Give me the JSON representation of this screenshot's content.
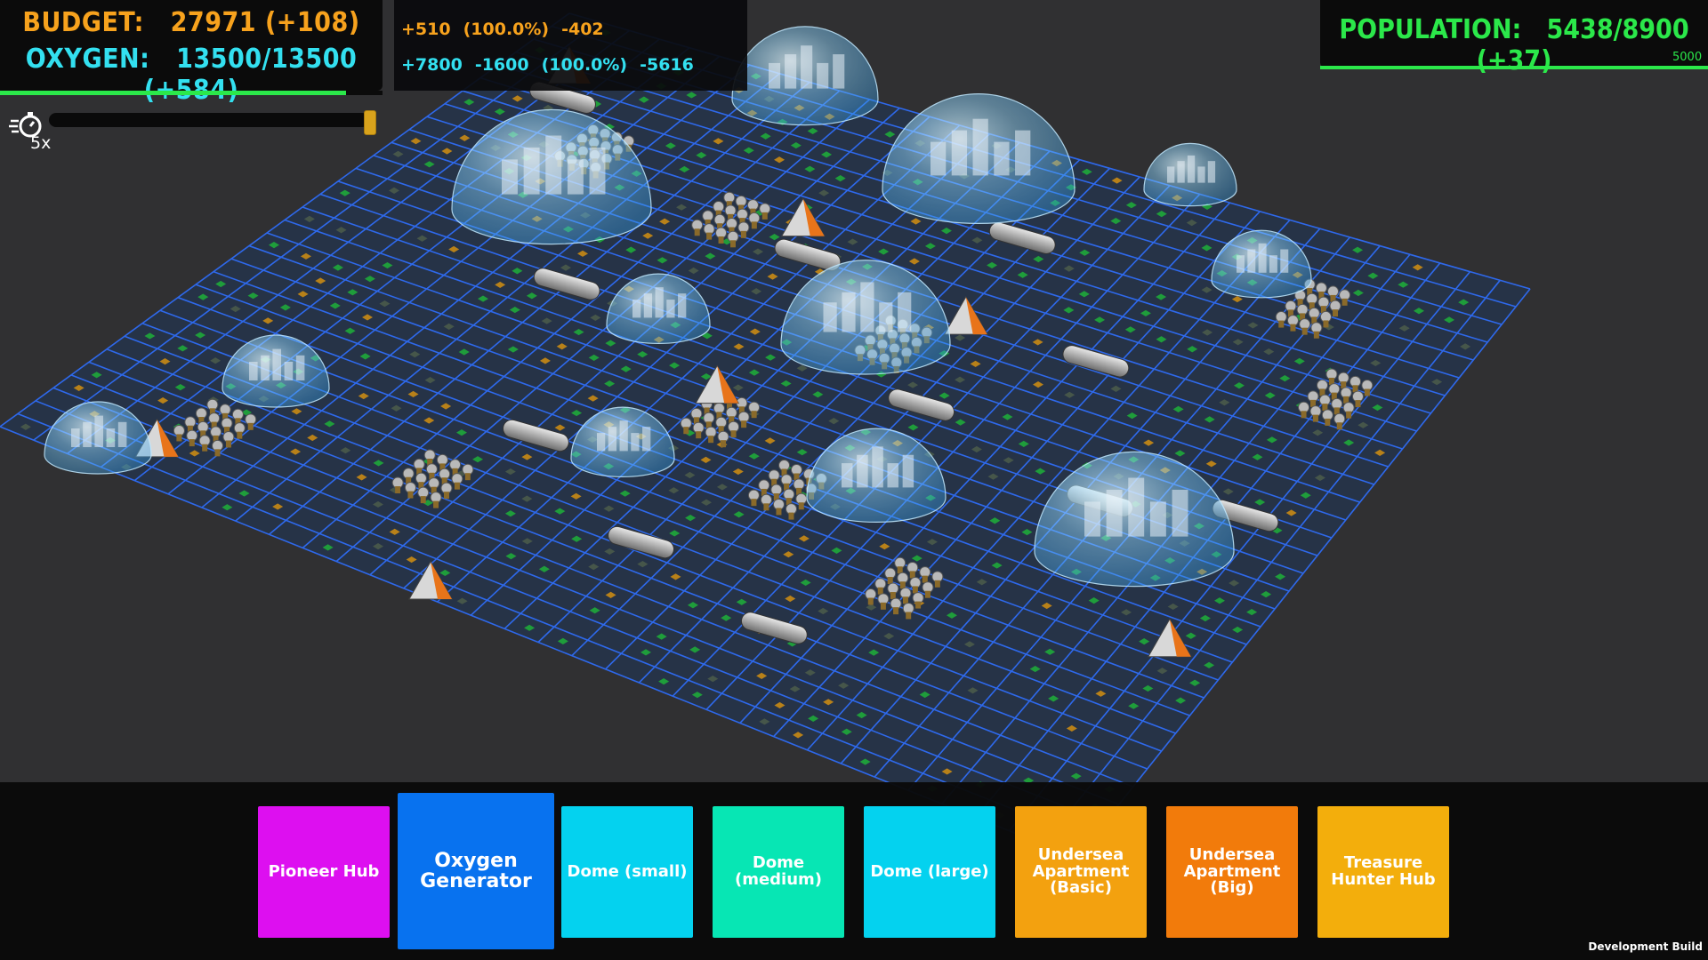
{
  "resources": {
    "budget_label": "BUDGET:",
    "budget_value": "27971",
    "budget_delta": "(+108)",
    "oxygen_label": "OXYGEN:",
    "oxygen_value": "13500/13500",
    "oxygen_delta": "(+584)",
    "oxygen_fill_fraction": 0.905
  },
  "rates": {
    "budget_income": "+510",
    "budget_efficiency": "(100.0%)",
    "budget_expense": "-402",
    "oxygen_income": "+7800",
    "oxygen_expense": "-1600",
    "oxygen_efficiency": "(100.0%)",
    "oxygen_consumption": "-5616"
  },
  "population": {
    "label": "POPULATION:",
    "value": "5438/8900",
    "delta": "(+37)",
    "target": "5000",
    "fill_fraction": 1.0
  },
  "speed": {
    "label": "5x",
    "icon": "stopwatch-icon",
    "level_fraction": 1.0
  },
  "build_menu": [
    {
      "label": "Pioneer Hub",
      "color": "#dd0ff0",
      "selected": false
    },
    {
      "label": "Oxygen Generator",
      "color": "#0872ef",
      "selected": true
    },
    {
      "label": "Dome (small)",
      "color": "#04d2ef",
      "selected": false
    },
    {
      "label": "Dome (medium)",
      "color": "#07e6b4",
      "selected": false
    },
    {
      "label": "Dome (large)",
      "color": "#04d2ef",
      "selected": false
    },
    {
      "label": "Undersea Apartment (Basic)",
      "color": "#f3a10f",
      "selected": false
    },
    {
      "label": "Undersea Apartment (Big)",
      "color": "#f27b0b",
      "selected": false
    },
    {
      "label": "Treasure Hunter Hub",
      "color": "#f3ae0c",
      "selected": false
    }
  ],
  "footer": {
    "dev_build": "Development Build"
  },
  "colors": {
    "grid_line": "#2f6cf5",
    "board_fill": "#263347",
    "budget": "#f7a21d",
    "oxygen": "#33e0f0",
    "population": "#2be84a",
    "dome": "#8fd6ff"
  }
}
